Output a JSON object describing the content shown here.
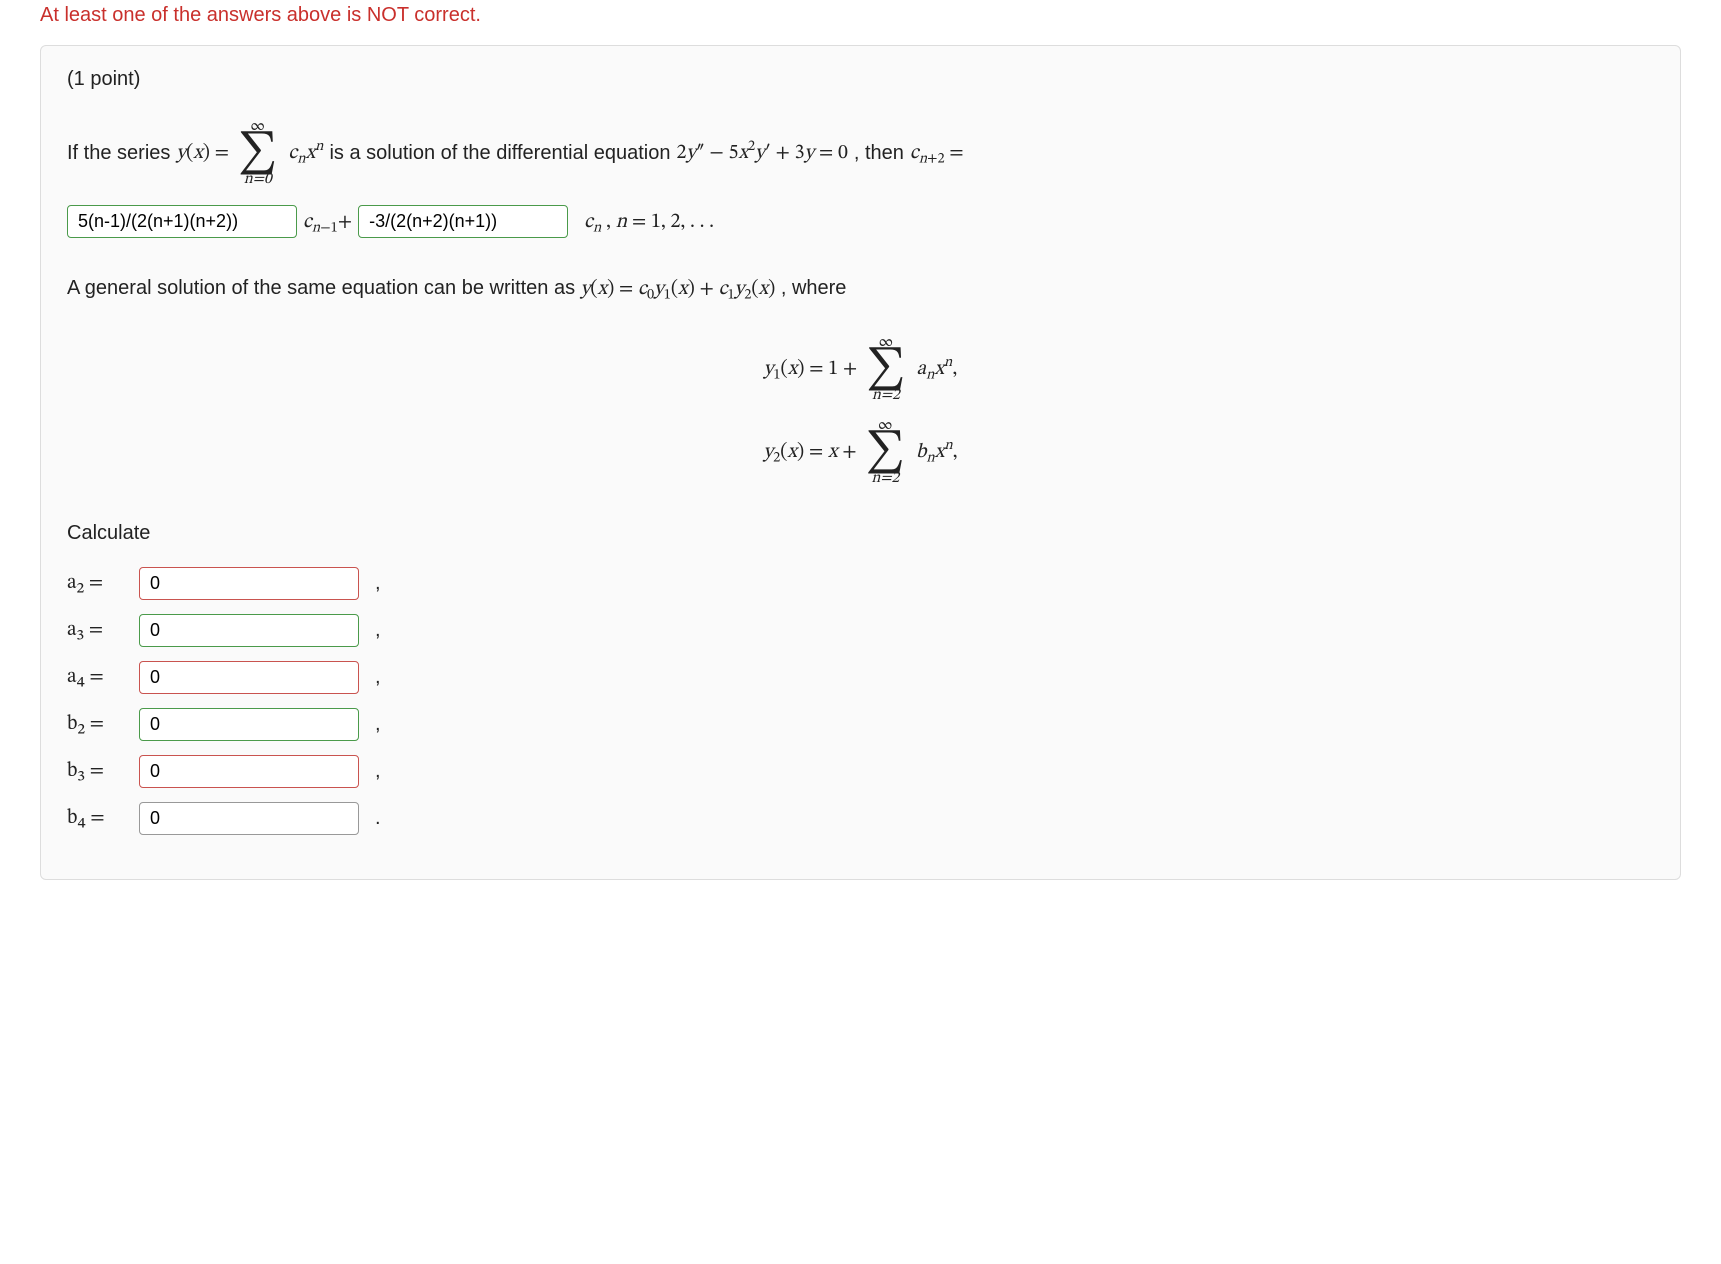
{
  "error_message": "At least one of the answers above is NOT correct.",
  "points_label": "(1 point)",
  "problem": {
    "intro_prefix": "If the series ",
    "y_of_x": "y(x) = ",
    "sum1_top": "∞",
    "sum1_bot": "n=0",
    "sum1_body": "cₙxⁿ",
    "intro_mid": " is a solution of the differential equation ",
    "ode": "2y″ − 5x²y′ + 3y = 0",
    "intro_then": ", then ",
    "cnp2": "cₙ₊₂ =",
    "input1_value": "5(n-1)/(2(n+1)(n+2))",
    "between_inputs": "cₙ₋₁+",
    "input2_value": "-3/(2(n+2)(n+1))",
    "after_inputs": "cₙ , n = 1, 2, . . .",
    "general_text_a": "A general solution of the same equation can be written as ",
    "general_eq": "y(x) = c₀y₁(x) + c₁y₂(x)",
    "general_text_b": ", where",
    "y1_lhs": "y₁(x) = 1 + ",
    "y1_sum_top": "∞",
    "y1_sum_bot": "n=2",
    "y1_body": "aₙxⁿ,",
    "y2_lhs": "y₂(x) = x + ",
    "y2_sum_top": "∞",
    "y2_sum_bot": "n=2",
    "y2_body": "bₙxⁿ,",
    "calculate_label": "Calculate"
  },
  "answers": [
    {
      "label": "a₂ =",
      "value": "0",
      "status": "red",
      "terminator": ","
    },
    {
      "label": "a₃ =",
      "value": "0",
      "status": "green",
      "terminator": ","
    },
    {
      "label": "a₄ =",
      "value": "0",
      "status": "red",
      "terminator": ","
    },
    {
      "label": "b₂ =",
      "value": "0",
      "status": "green",
      "terminator": ","
    },
    {
      "label": "b₃ =",
      "value": "0",
      "status": "red",
      "terminator": ","
    },
    {
      "label": "b₄ =",
      "value": "0",
      "status": "plain",
      "terminator": "."
    }
  ]
}
